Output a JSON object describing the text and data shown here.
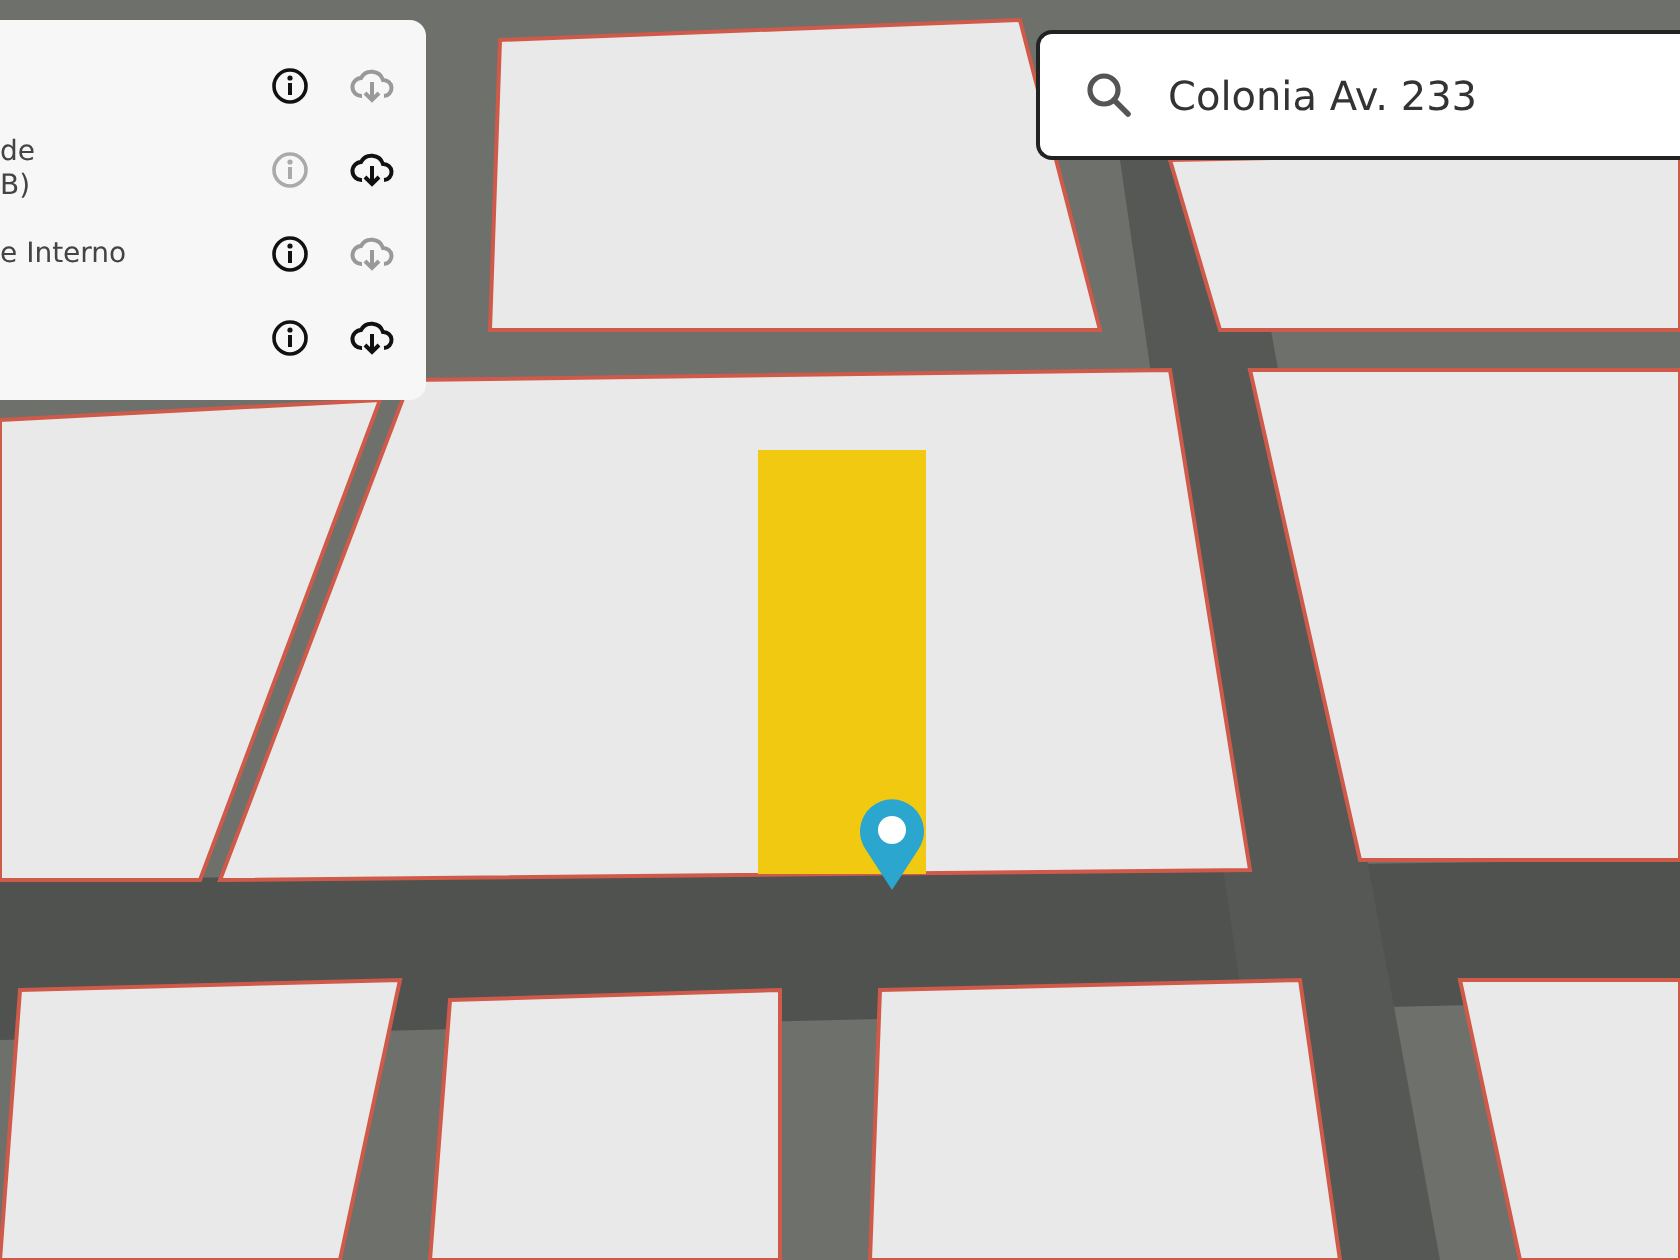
{
  "layers_panel": {
    "rows": [
      {
        "info_disabled": false,
        "download_disabled": true
      },
      {
        "label_lines": [
          "de",
          "B)"
        ],
        "info_disabled": true,
        "download_disabled": false
      },
      {
        "label_lines": [
          "e Interno"
        ],
        "info_disabled": false,
        "download_disabled": true
      },
      {
        "info_disabled": false,
        "download_disabled": false
      }
    ]
  },
  "search": {
    "value": "Colonia Av. 233"
  }
}
